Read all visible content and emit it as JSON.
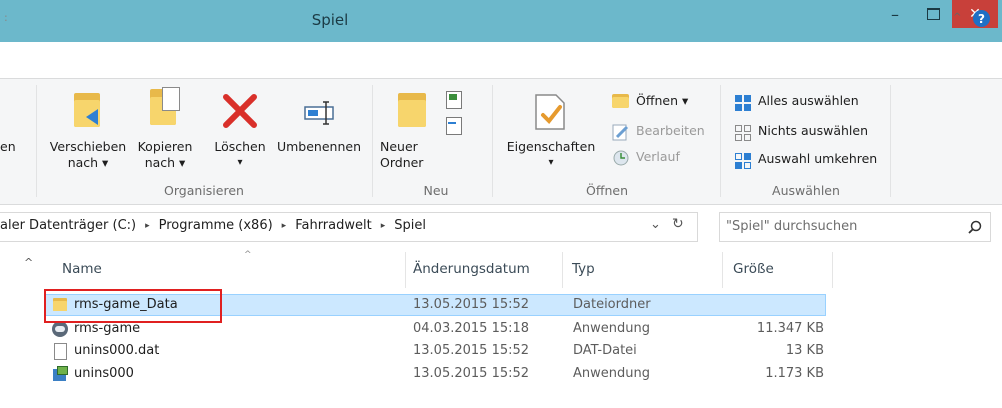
{
  "window": {
    "title": "Spiel",
    "min": "–",
    "close": "✕",
    "tab_stub": ":",
    "collapse": "^",
    "help": "?"
  },
  "ribbon": {
    "cut_label": "en",
    "organisieren": {
      "label": "Organisieren",
      "move": [
        "Verschieben",
        "nach ▾"
      ],
      "copy": [
        "Kopieren",
        "nach ▾"
      ],
      "delete": "Löschen",
      "delete_arrow": "▾",
      "rename": "Umbenennen"
    },
    "neu": {
      "label": "Neu",
      "new_folder": [
        "Neuer",
        "Ordner"
      ]
    },
    "oeffnen": {
      "label": "Öffnen",
      "properties": "Eigenschaften",
      "properties_arrow": "▾",
      "open": "Öffnen ▾",
      "edit": "Bearbeiten",
      "history": "Verlauf"
    },
    "auswaehlen": {
      "label": "Auswählen",
      "select_all": "Alles auswählen",
      "select_none": "Nichts auswählen",
      "invert": "Auswahl umkehren"
    }
  },
  "address": {
    "crumbs": [
      "aler Datenträger (C:)",
      "Programme (x86)",
      "Fahrradwelt",
      "Spiel"
    ],
    "sep": "▸",
    "dropdown": "⌄",
    "refresh": "↻",
    "search_placeholder": "\"Spiel\" durchsuchen",
    "scroll_up": "^"
  },
  "columns": {
    "name": "Name",
    "date": "Änderungsdatum",
    "type": "Typ",
    "size": "Größe",
    "sort_arrow": "^"
  },
  "files": [
    {
      "name": "rms-game_Data",
      "date": "13.05.2015 15:52",
      "type": "Dateiordner",
      "size": "",
      "icon": "folder-icon",
      "selected": true
    },
    {
      "name": "rms-game",
      "date": "04.03.2015 15:18",
      "type": "Anwendung",
      "size": "11.347 KB",
      "icon": "app-icon"
    },
    {
      "name": "unins000.dat",
      "date": "13.05.2015 15:52",
      "type": "DAT-Datei",
      "size": "13 KB",
      "icon": "file-icon"
    },
    {
      "name": "unins000",
      "date": "13.05.2015 15:52",
      "type": "Anwendung",
      "size": "1.173 KB",
      "icon": "installer-icon"
    }
  ],
  "colors": {
    "titlebar": "#6cb8cb",
    "close": "#c8403a",
    "selection": "#cce8ff",
    "highlight": "#e02020"
  }
}
